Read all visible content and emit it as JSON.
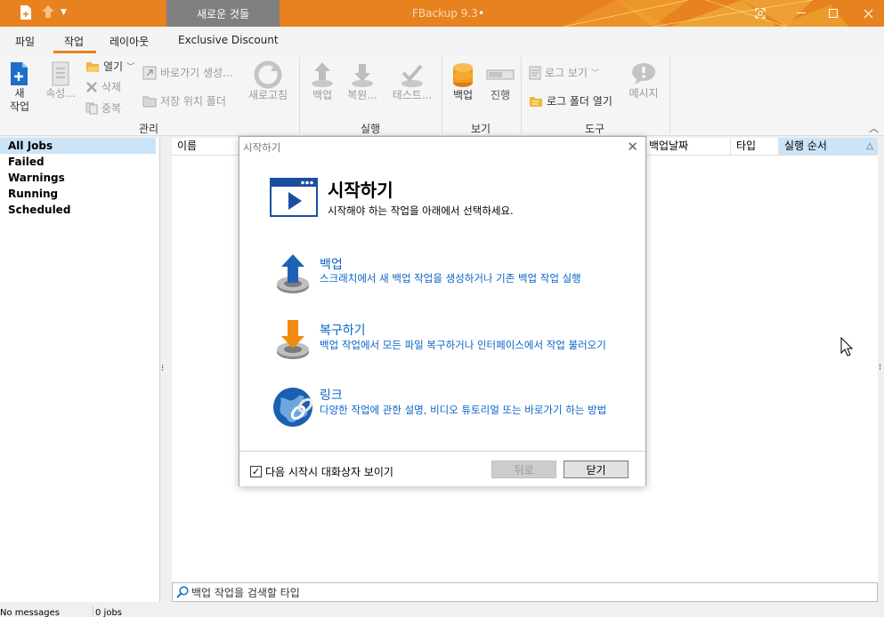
{
  "titlebar": {
    "whats_new": "새로운 것들",
    "app_title": "FBackup 9.3",
    "bullet": "•",
    "colors": {
      "bar": "#e8821e",
      "whats_new_bg": "#7f7f7f"
    }
  },
  "menu_tabs": [
    "파일",
    "작업",
    "레이아웃",
    "Exclusive Discount"
  ],
  "ribbon": {
    "new_job": "새\n작업",
    "properties": "속성...",
    "open": "열기",
    "delete": "삭제",
    "duplicate": "중복",
    "create_shortcut": "바로가기 생성...",
    "storage_folder": "저장 위치 폴더",
    "refresh": "새로고침",
    "group_manage": "관리",
    "backup_run": "백업",
    "restore": "복원...",
    "test": "테스트...",
    "group_run": "실행",
    "view_backup": "백업",
    "view_progress": "진행",
    "group_view": "보기",
    "log_view": "로그 보기",
    "open_log_folder": "로그 폴더 열기",
    "messages": "메시지",
    "group_tools": "도구"
  },
  "nav": {
    "items": [
      "All Jobs",
      "Failed",
      "Warnings",
      "Running",
      "Scheduled"
    ],
    "selected": "All Jobs"
  },
  "grid": {
    "columns": [
      "이름",
      "백업날짜",
      "타입",
      "실행 순서"
    ],
    "sort_column": "실행 순서",
    "sort_indicator": "△"
  },
  "search": {
    "placeholder": "백업 작업을 검색할 타입"
  },
  "status": {
    "messages": "No messages",
    "jobs": "0 jobs"
  },
  "dialog": {
    "title": "시작하기",
    "heading": "시작하기",
    "subtitle": "시작해야 하는 작업을 아래에서 선택하세요.",
    "options": [
      {
        "title": "백업",
        "desc": "스크래치에서 새 백업 작업을 생성하거나 기존 백업 작업 실행",
        "icon": "backup-up-arrow-icon"
      },
      {
        "title": "복구하기",
        "desc": "백업 작업에서 모든 파일 복구하거나 인터페이스에서 작업 불러오기",
        "icon": "restore-down-arrow-icon"
      },
      {
        "title": "링크",
        "desc": "다양한 작업에 관한 설명, 비디오 튜토리얼 또는 바로가기 하는 방법",
        "icon": "globe-link-icon"
      }
    ],
    "show_on_startup": "다음 시작시 대화상자 보이기",
    "show_on_startup_checked": true,
    "back_button": "뒤로",
    "close_button": "닫기",
    "link_color": "#0a64c8"
  }
}
